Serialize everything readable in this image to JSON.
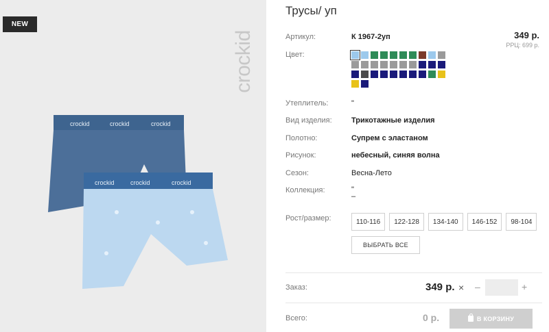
{
  "badge": "NEW",
  "brand": "crockid",
  "product": {
    "title": "Трусы/ уп",
    "article_label": "Артикул:",
    "article": "К 1967-2уп",
    "price": "349 р.",
    "rrc": "РРЦ: 699 р.",
    "color_label": "Цвет:",
    "colors": [
      "#9cc9ec",
      "#9cc9ec",
      "#2e8b57",
      "#2e8b57",
      "#2e8b57",
      "#2e8b57",
      "#2e8b57",
      "#7b3a2a",
      "#9cc9ec",
      "#9a9a9a",
      "#9a9a9a",
      "#9a9a9a",
      "#9a9a9a",
      "#9a9a9a",
      "#9a9a9a",
      "#9a9a9a",
      "#9a9a9a",
      "#1a1a7a",
      "#1a1a7a",
      "#1a1a7a",
      "#1a1a7a",
      "#4a4a4a",
      "#1a1a7a",
      "#1a1a7a",
      "#1a1a7a",
      "#1a1a7a",
      "#1a1a7a",
      "#1a1a7a",
      "#2e8b57",
      "#e8c21a",
      "#e8c21a",
      "#1a1a7a"
    ],
    "insulation_label": "Утеплитель:",
    "insulation": "\"",
    "type_label": "Вид изделия:",
    "type": "Трикотажные изделия",
    "fabric_label": "Полотно:",
    "fabric": "Супрем с эластаном",
    "pattern_label": "Рисунок:",
    "pattern": "небесный, синяя волна",
    "season_label": "Сезон:",
    "season": "Весна-Лето",
    "collection_label": "Коллекция:",
    "collection": "\"",
    "collection_dash": "–",
    "size_label": "Рост/размер:",
    "sizes": [
      "110-116",
      "122-128",
      "134-140",
      "146-152",
      "98-104"
    ],
    "select_all": "ВЫБРАТЬ ВСЕ"
  },
  "order": {
    "label": "Заказ:",
    "price": "349 р.",
    "times": "×",
    "minus": "–",
    "quantity": "",
    "plus": "+",
    "total_label": "Всего:",
    "total": "0 р.",
    "cart_button": "В КОРЗИНУ"
  }
}
